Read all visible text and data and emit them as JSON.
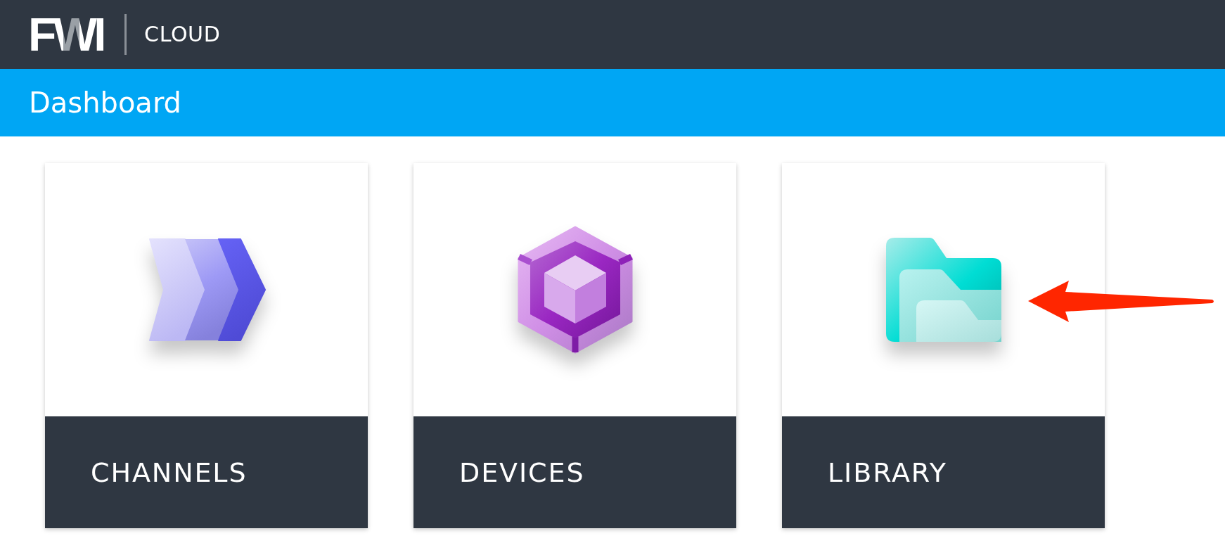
{
  "header": {
    "logo": "FWI",
    "product": "CLOUD"
  },
  "title_bar": {
    "title": "Dashboard"
  },
  "tiles": [
    {
      "label": "CHANNELS"
    },
    {
      "label": "DEVICES"
    },
    {
      "label": "LIBRARY"
    }
  ]
}
